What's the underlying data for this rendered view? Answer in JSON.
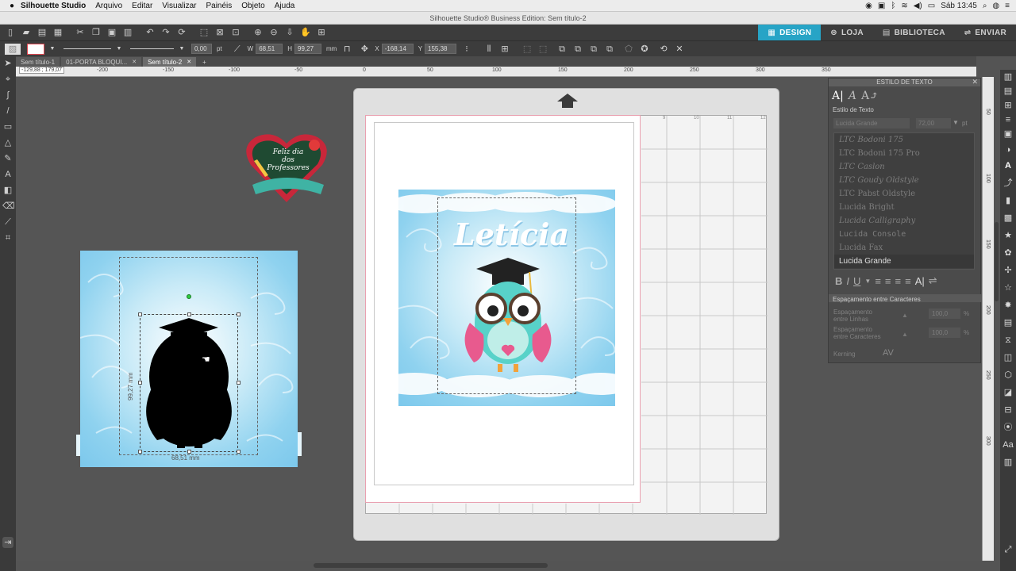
{
  "menubar": {
    "apple": "",
    "app_name": "Silhouette Studio",
    "items": [
      "Arquivo",
      "Editar",
      "Visualizar",
      "Painéis",
      "Objeto",
      "Ajuda"
    ],
    "clock": "Sáb 13:45"
  },
  "window_title": "Silhouette Studio® Business Edition: Sem título-2",
  "nav_tabs": [
    {
      "label": "DESIGN",
      "icon": "grid-icon",
      "active": true
    },
    {
      "label": "LOJA",
      "icon": "store-icon",
      "active": false
    },
    {
      "label": "BIBLIOTECA",
      "icon": "library-icon",
      "active": false
    },
    {
      "label": "ENVIAR",
      "icon": "send-icon",
      "active": false
    }
  ],
  "toolbar2": {
    "line_width": "0,00",
    "line_unit": "pt",
    "w_label": "W",
    "w_value": "68,51",
    "h_label": "H",
    "h_value": "99,27",
    "size_unit": "mm",
    "x_label": "X",
    "x_value": "-168,14",
    "y_label": "Y",
    "y_value": "155,38",
    "pos_unit": "mm"
  },
  "doc_tabs": [
    {
      "label": "Sem título-1",
      "active": false
    },
    {
      "label": "01-PORTA BLOQUI...",
      "active": false
    },
    {
      "label": "Sem título-2",
      "active": true
    }
  ],
  "add_tab": "+",
  "cursor_coords": "-129,88 ; 179,07",
  "ruler_h_labels": [
    "-200",
    "-150",
    "-100",
    "-50",
    "0",
    "50",
    "100",
    "150",
    "200",
    "250",
    "300",
    "350"
  ],
  "ruler_v_labels": [
    "50",
    "100",
    "150",
    "200",
    "250",
    "300"
  ],
  "grid_numbers": [
    "9",
    "10",
    "11",
    "12"
  ],
  "artwork": {
    "sticker_lines": [
      "Feliz dia",
      "dos",
      "Professores"
    ],
    "name_text": "Letícia",
    "dim_width": "68,51 mm",
    "dim_height": "99,27 mm"
  },
  "brand_mark": "silhouette",
  "text_panel": {
    "header": "ESTILO DE TEXTO",
    "close": "✕",
    "section": "Estilo de Texto",
    "font_name": "Lucida Grande",
    "font_size": "72,00",
    "font_unit": "pt",
    "fonts": [
      {
        "name": "LTC Bodoni 175",
        "selected": false
      },
      {
        "name": "LTC Bodoni 175 Pro",
        "selected": false
      },
      {
        "name": "LTC Caslon",
        "selected": false
      },
      {
        "name": "LTC Goudy Oldstyle",
        "selected": false
      },
      {
        "name": "LTC Pabst Oldstyle",
        "selected": false
      },
      {
        "name": "Lucida Bright",
        "selected": false
      },
      {
        "name": "Lucida Calligraphy",
        "selected": false
      },
      {
        "name": "Lucida Console",
        "selected": false
      },
      {
        "name": "Lucida Fax",
        "selected": false
      },
      {
        "name": "Lucida Grande",
        "selected": true
      }
    ],
    "style_buttons": [
      "B",
      "I",
      "U"
    ],
    "spacing_section": "Espaçamento entre Caracteres",
    "line_spacing_label": "Espaçamento entre Linhas",
    "line_spacing_value": "100,0",
    "char_spacing_label": "Espaçamento entre Caracteres",
    "char_spacing_value": "100,0",
    "percent": "%",
    "kerning_label": "Kerning",
    "kerning_value": "AV"
  },
  "colors": {
    "accent": "#27a4c6",
    "background": "#545454",
    "toolbar": "#3c3c3c"
  }
}
